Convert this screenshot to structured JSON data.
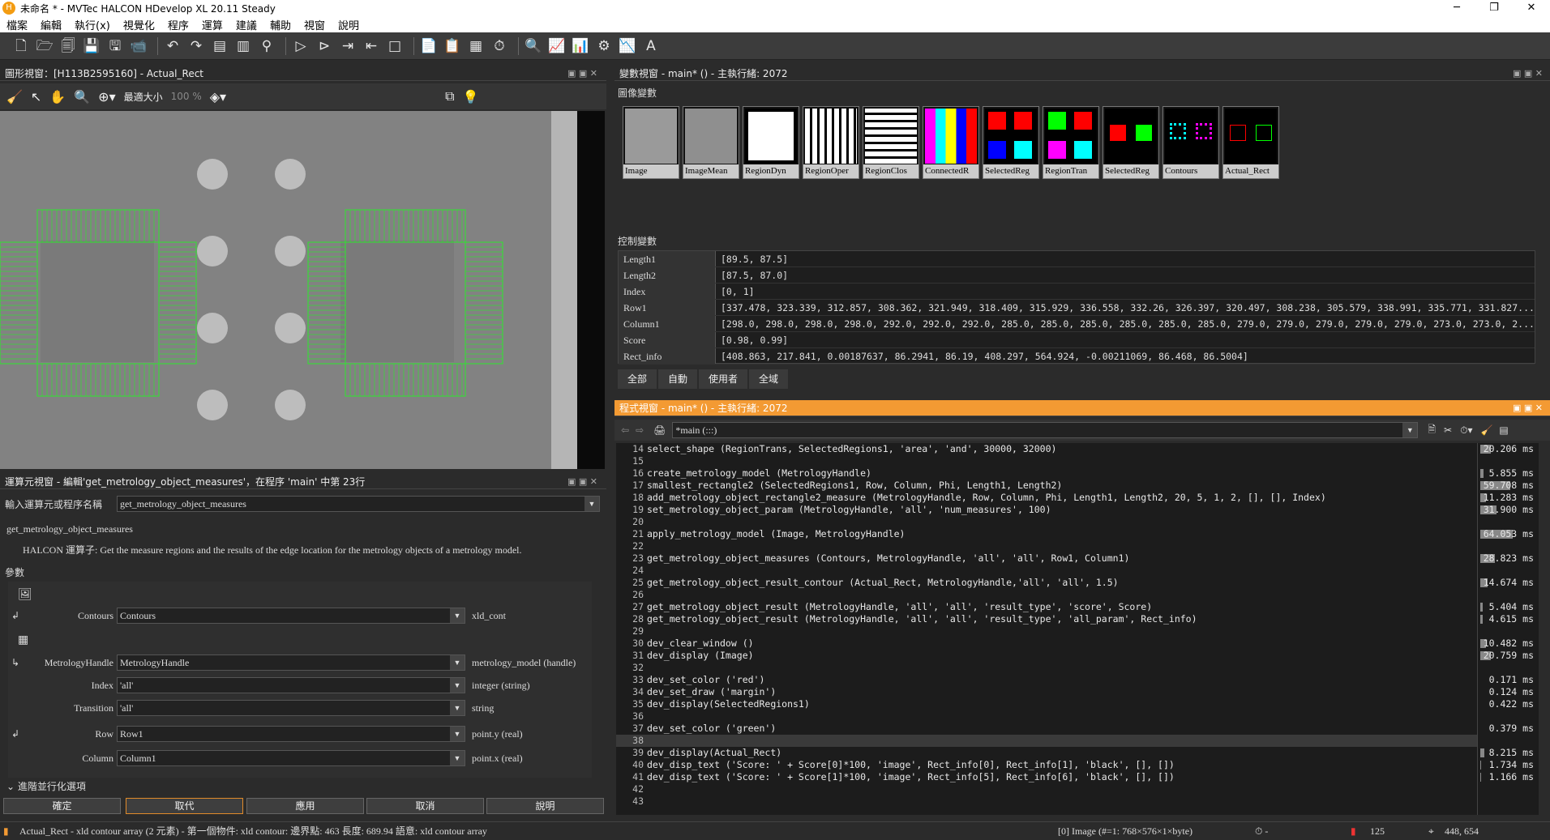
{
  "window": {
    "title": "未命名 * - MVTec HALCON HDevelop XL 20.11 Steady"
  },
  "menu": [
    "檔案",
    "編輯",
    "執行(x)",
    "視覺化",
    "程序",
    "運算",
    "建議",
    "輔助",
    "視窗",
    "說明"
  ],
  "graphics": {
    "header": "圖形視窗：[H113B2595160] - Actual_Rect",
    "fit_label": "最適大小",
    "zoom_label": "100 %"
  },
  "variables": {
    "header": "變數視窗 - main* () - 主執行緒: 2072",
    "iconic_title": "圖像變數",
    "iconic": [
      "Image",
      "ImageMean",
      "RegionDyn",
      "RegionOper",
      "RegionClos",
      "ConnectedR",
      "SelectedReg",
      "RegionTran",
      "SelectedReg",
      "Contours",
      "Actual_Rect"
    ],
    "control_title": "控制變數",
    "control": [
      {
        "name": "Length1",
        "value": "[89.5, 87.5]"
      },
      {
        "name": "Length2",
        "value": "[87.5, 87.0]"
      },
      {
        "name": "Index",
        "value": "[0, 1]"
      },
      {
        "name": "Row1",
        "value": "[337.478, 323.339, 312.857, 308.362, 321.949, 318.409, 315.929, 336.558, 332.26, 326.397, 320.497, 308.238, 305.579, 338.991, 335.771, 331.827..."
      },
      {
        "name": "Column1",
        "value": "[298.0, 298.0, 298.0, 298.0, 292.0, 292.0, 292.0, 285.0, 285.0, 285.0, 285.0, 285.0, 285.0, 279.0, 279.0, 279.0, 279.0, 279.0, 273.0, 273.0, 2..."
      },
      {
        "name": "Score",
        "value": "[0.98, 0.99]"
      },
      {
        "name": "Rect_info",
        "value": "[408.863, 217.841, 0.00187637, 86.2941, 86.19, 408.297, 564.924, -0.00211069, 86.468, 86.5004]"
      }
    ],
    "tabs": [
      "全部",
      "自動",
      "使用者",
      "全域"
    ]
  },
  "program": {
    "header": "程式視窗 - main* () - 主執行緒: 2072",
    "proc_select": "*main (:::)",
    "lines": [
      {
        "n": "14",
        "code": "select_shape (RegionTrans, SelectedRegions1, 'area', 'and', 30000, 32000)",
        "t": "20.206 ms"
      },
      {
        "n": "15",
        "code": "",
        "t": ""
      },
      {
        "n": "16",
        "code": "create_metrology_model (MetrologyHandle)",
        "t": "5.855 ms"
      },
      {
        "n": "17",
        "code": "smallest_rectangle2 (SelectedRegions1, Row, Column, Phi, Length1, Length2)",
        "t": "59.708 ms"
      },
      {
        "n": "18",
        "code": "add_metrology_object_rectangle2_measure (MetrologyHandle, Row, Column, Phi, Length1, Length2, 20, 5, 1, 2, [], [], Index)",
        "t": "11.283 ms"
      },
      {
        "n": "19",
        "code": "set_metrology_object_param (MetrologyHandle, 'all', 'num_measures', 100)",
        "t": "31.900 ms"
      },
      {
        "n": "20",
        "code": "",
        "t": ""
      },
      {
        "n": "21",
        "code": "apply_metrology_model (Image, MetrologyHandle)",
        "t": "64.053 ms"
      },
      {
        "n": "22",
        "code": "",
        "t": ""
      },
      {
        "n": "23",
        "code": "get_metrology_object_measures (Contours, MetrologyHandle, 'all', 'all', Row1, Column1)",
        "t": "28.823 ms"
      },
      {
        "n": "24",
        "code": "",
        "t": ""
      },
      {
        "n": "25",
        "code": "get_metrology_object_result_contour (Actual_Rect, MetrologyHandle,'all', 'all', 1.5)",
        "t": "14.674 ms"
      },
      {
        "n": "26",
        "code": "",
        "t": ""
      },
      {
        "n": "27",
        "code": "get_metrology_object_result (MetrologyHandle, 'all', 'all', 'result_type', 'score', Score)",
        "t": "5.404 ms"
      },
      {
        "n": "28",
        "code": "get_metrology_object_result (MetrologyHandle, 'all', 'all', 'result_type', 'all_param', Rect_info)",
        "t": "4.615 ms"
      },
      {
        "n": "29",
        "code": "",
        "t": ""
      },
      {
        "n": "30",
        "code": "dev_clear_window ()",
        "t": "10.482 ms"
      },
      {
        "n": "31",
        "code": "dev_display (Image)",
        "t": "20.759 ms"
      },
      {
        "n": "32",
        "code": "",
        "t": ""
      },
      {
        "n": "33",
        "code": "dev_set_color ('red')",
        "t": "0.171 ms"
      },
      {
        "n": "34",
        "code": "dev_set_draw ('margin')",
        "t": "0.124 ms"
      },
      {
        "n": "35",
        "code": "dev_display(SelectedRegions1)",
        "t": "0.422 ms"
      },
      {
        "n": "36",
        "code": "",
        "t": ""
      },
      {
        "n": "37",
        "code": "dev_set_color ('green')",
        "t": "0.379 ms"
      },
      {
        "n": "38",
        "code": "",
        "t": ""
      },
      {
        "n": "39",
        "code": "dev_display(Actual_Rect)",
        "t": "8.215 ms"
      },
      {
        "n": "40",
        "code": "dev_disp_text ('Score: ' + Score[0]*100, 'image', Rect_info[0], Rect_info[1], 'black', [], [])",
        "t": "1.734 ms"
      },
      {
        "n": "41",
        "code": "dev_disp_text ('Score: ' + Score[1]*100, 'image', Rect_info[5], Rect_info[6], 'black', [], [])",
        "t": "1.166 ms"
      },
      {
        "n": "42",
        "code": "",
        "t": ""
      },
      {
        "n": "43",
        "code": "",
        "t": ""
      }
    ]
  },
  "operator": {
    "header": "運算元視窗 - 編輯'get_metrology_object_measures'，在程序 'main' 中第 23行",
    "input_label": "輸入運算元或程序名稱",
    "input_value": "get_metrology_object_measures",
    "op_name": "get_metrology_object_measures",
    "desc": "HALCON 運算子:  Get the measure regions and the results of the edge location for the metrology objects of a metrology model.",
    "params_title": "參數",
    "params": [
      {
        "label": "Contours",
        "value": "Contours",
        "type": "xld_cont"
      },
      {
        "label": "MetrologyHandle",
        "value": "MetrologyHandle",
        "type": "metrology_model (handle)"
      },
      {
        "label": "Index",
        "value": "'all'",
        "type": "integer (string)"
      },
      {
        "label": "Transition",
        "value": "'all'",
        "type": "string"
      },
      {
        "label": "Row",
        "value": "Row1",
        "type": "point.y (real)"
      },
      {
        "label": "Column",
        "value": "Column1",
        "type": "point.x (real)"
      }
    ],
    "advanced": "進階並行化選項",
    "buttons": [
      "確定",
      "取代",
      "應用",
      "取消",
      "說明"
    ]
  },
  "status": {
    "left": "Actual_Rect - xld contour array (2 元素) - 第一個物件: xld contour: 邊界點: 463 長度: 689.94 語意: xld contour array",
    "image_info": "[0] Image (#=1: 768×576×1×byte)",
    "value": "125",
    "coords": "448, 654"
  },
  "colors": {
    "accent": "#f39a33",
    "overlay": "#2ee62e"
  }
}
